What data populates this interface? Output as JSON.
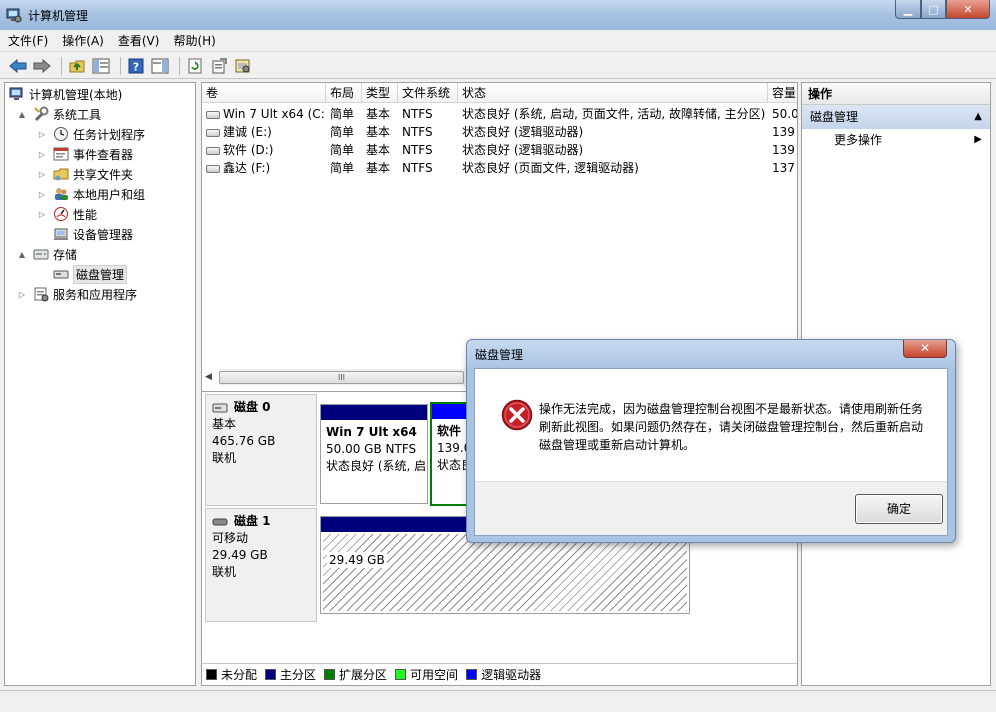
{
  "window": {
    "title": "计算机管理"
  },
  "menu": [
    "文件(F)",
    "操作(A)",
    "查看(V)",
    "帮助(H)"
  ],
  "tree": {
    "root": "计算机管理(本地)",
    "items": [
      {
        "label": "系统工具",
        "level": 1,
        "expander": "▲"
      },
      {
        "label": "任务计划程序",
        "level": 2,
        "expander": "▷"
      },
      {
        "label": "事件查看器",
        "level": 2,
        "expander": "▷"
      },
      {
        "label": "共享文件夹",
        "level": 2,
        "expander": "▷"
      },
      {
        "label": "本地用户和组",
        "level": 2,
        "expander": "▷"
      },
      {
        "label": "性能",
        "level": 2,
        "expander": "▷"
      },
      {
        "label": "设备管理器",
        "level": 2,
        "expander": ""
      },
      {
        "label": "存储",
        "level": 1,
        "expander": "▲"
      },
      {
        "label": "磁盘管理",
        "level": 2,
        "expander": "",
        "selected": true
      },
      {
        "label": "服务和应用程序",
        "level": 1,
        "expander": "▷"
      }
    ]
  },
  "volumes": {
    "headers": [
      "卷",
      "布局",
      "类型",
      "文件系统",
      "状态",
      "容量"
    ],
    "rows": [
      [
        "Win 7 Ult x64 (C:)",
        "简单",
        "基本",
        "NTFS",
        "状态良好 (系统, 启动, 页面文件, 活动, 故障转储, 主分区)",
        "50.0"
      ],
      [
        "建诚 (E:)",
        "简单",
        "基本",
        "NTFS",
        "状态良好 (逻辑驱动器)",
        "139"
      ],
      [
        "软件 (D:)",
        "简单",
        "基本",
        "NTFS",
        "状态良好 (逻辑驱动器)",
        "139"
      ],
      [
        "鑫达 (F:)",
        "简单",
        "基本",
        "NTFS",
        "状态良好 (页面文件, 逻辑驱动器)",
        "137"
      ]
    ]
  },
  "disks": [
    {
      "name": "磁盘 0",
      "type": "基本",
      "size": "465.76 GB",
      "status": "联机",
      "partitions": [
        {
          "title": "Win 7 Ult x64",
          "cut": "(",
          "size": "50.00 GB NTFS",
          "status": "状态良好 (系统, 启"
        },
        {
          "title": "软件",
          "size": "139.0",
          "status": "状态良"
        }
      ]
    },
    {
      "name": "磁盘 1",
      "type": "可移动",
      "size": "29.49 GB",
      "status": "联机",
      "partitions": [
        {
          "title": "",
          "size": "29.49 GB",
          "status": ""
        }
      ]
    }
  ],
  "legend": [
    {
      "label": "未分配",
      "color": "#000000"
    },
    {
      "label": "主分区",
      "color": "#00007c"
    },
    {
      "label": "扩展分区",
      "color": "#007c00"
    },
    {
      "label": "可用空间",
      "color": "#19ff19"
    },
    {
      "label": "逻辑驱动器",
      "color": "#0000ff"
    }
  ],
  "actions": {
    "header": "操作",
    "section": "磁盘管理",
    "more": "更多操作"
  },
  "dialog": {
    "title": "磁盘管理",
    "message": "操作无法完成，因为磁盘管理控制台视图不是最新状态。请使用刷新任务刷新此视图。如果问题仍然存在，请关闭磁盘管理控制台，然后重新启动磁盘管理或重新启动计算机。",
    "ok": "确定",
    "close": "✕"
  },
  "scroll_grip": "III"
}
